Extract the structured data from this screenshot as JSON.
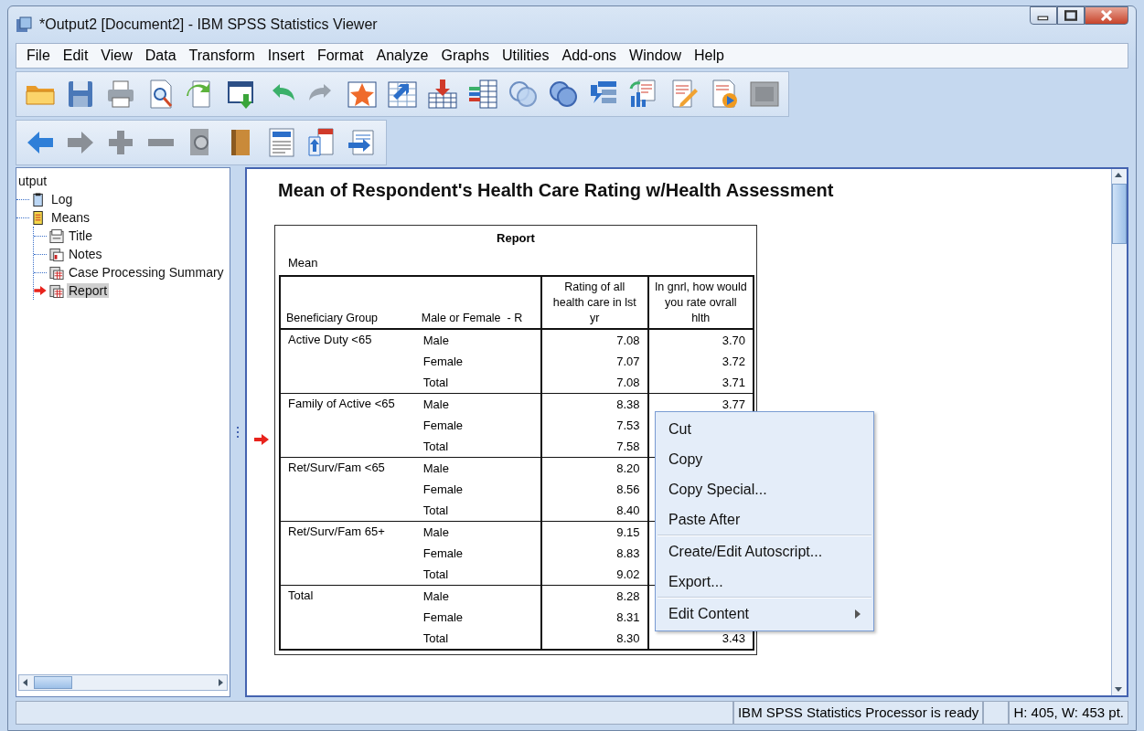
{
  "window": {
    "title": "*Output2 [Document2] - IBM SPSS Statistics Viewer"
  },
  "menu_bar": [
    "File",
    "Edit",
    "View",
    "Data",
    "Transform",
    "Insert",
    "Format",
    "Analyze",
    "Graphs",
    "Utilities",
    "Add-ons",
    "Window",
    "Help"
  ],
  "outline": [
    {
      "label": "utput",
      "selected": false,
      "current": false,
      "children": [
        {
          "label": "Log",
          "kind": "log",
          "selected": false,
          "current": false
        },
        {
          "label": "Means",
          "kind": "procedure",
          "selected": false,
          "current": false,
          "children": [
            {
              "label": "Title",
              "kind": "title",
              "selected": false,
              "current": false
            },
            {
              "label": "Notes",
              "kind": "notes",
              "selected": false,
              "current": false
            },
            {
              "label": "Case Processing Summary",
              "kind": "table",
              "selected": false,
              "current": false
            },
            {
              "label": "Report",
              "kind": "table",
              "selected": true,
              "current": true
            }
          ]
        }
      ]
    }
  ],
  "viewer": {
    "heading": "Mean of Respondent's Health Care Rating w/Health Assessment",
    "report": {
      "title": "Report",
      "subtitle": "Mean",
      "columns": [
        "Beneficiary Group",
        "Male or Female  - R",
        "Rating of all health care in lst yr",
        "In gnrl, how would you rate ovrall hlth"
      ],
      "groups": [
        {
          "label": "Active Duty <65",
          "current": false,
          "rows": [
            {
              "sex": "Male",
              "rating": "7.08",
              "health": "3.70"
            },
            {
              "sex": "Female",
              "rating": "7.07",
              "health": "3.72"
            },
            {
              "sex": "Total",
              "rating": "7.08",
              "health": "3.71"
            }
          ]
        },
        {
          "label": "Family of Active <65",
          "current": true,
          "rows": [
            {
              "sex": "Male",
              "rating": "8.38",
              "health": "3.77"
            },
            {
              "sex": "Female",
              "rating": "7.53"
            },
            {
              "sex": "Total",
              "rating": "7.58"
            }
          ]
        },
        {
          "label": "Ret/Surv/Fam <65",
          "current": false,
          "rows": [
            {
              "sex": "Male",
              "rating": "8.20"
            },
            {
              "sex": "Female",
              "rating": "8.56"
            },
            {
              "sex": "Total",
              "rating": "8.40"
            }
          ]
        },
        {
          "label": "Ret/Surv/Fam 65+",
          "current": false,
          "rows": [
            {
              "sex": "Male",
              "rating": "9.15"
            },
            {
              "sex": "Female",
              "rating": "8.83"
            },
            {
              "sex": "Total",
              "rating": "9.02"
            }
          ]
        },
        {
          "label": "Total",
          "current": false,
          "rows": [
            {
              "sex": "Male",
              "rating": "8.28"
            },
            {
              "sex": "Female",
              "rating": "8.31"
            },
            {
              "sex": "Total",
              "rating": "8.30",
              "health": "3.43"
            }
          ]
        }
      ]
    }
  },
  "context_menu": [
    {
      "label": "Cut",
      "kind": "item",
      "submenu": false
    },
    {
      "label": "Copy",
      "kind": "item",
      "submenu": false
    },
    {
      "label": "Copy Special...",
      "kind": "item",
      "submenu": false
    },
    {
      "label": "Paste After",
      "kind": "item",
      "submenu": false
    },
    {
      "kind": "separator"
    },
    {
      "label": "Create/Edit Autoscript...",
      "kind": "item",
      "submenu": false
    },
    {
      "label": "Export...",
      "kind": "item",
      "submenu": false
    },
    {
      "kind": "separator"
    },
    {
      "label": "Edit Content",
      "kind": "item",
      "submenu": true
    }
  ],
  "status_bar": [
    "IBM SPSS Statistics Processor is ready",
    "H: 405, W: 453 pt."
  ]
}
